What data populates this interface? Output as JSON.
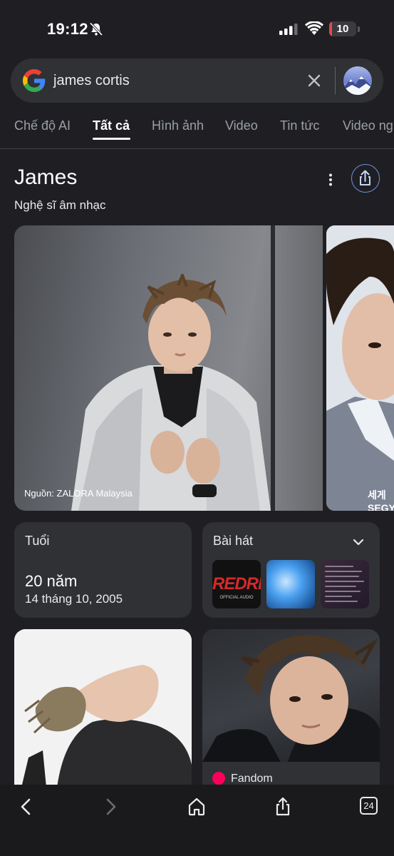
{
  "status_bar": {
    "time": "19:12",
    "battery": "10",
    "battery_level": 0.1
  },
  "search": {
    "query": "james cortis"
  },
  "tabs": [
    {
      "label": "Chế độ AI",
      "active": false
    },
    {
      "label": "Tất cả",
      "active": true
    },
    {
      "label": "Hình ảnh",
      "active": false
    },
    {
      "label": "Video",
      "active": false
    },
    {
      "label": "Tin tức",
      "active": false
    },
    {
      "label": "Video ng",
      "active": false
    }
  ],
  "knowledge_panel": {
    "title": "James",
    "subtitle": "Nghệ sĩ âm nhạc",
    "image_credit": "Nguồn: ZALORA Malaysia",
    "second_image_text": "세계\nSEGY"
  },
  "age_card": {
    "label": "Tuổi",
    "value": "20 năm",
    "date": "14 tháng 10, 2005"
  },
  "songs_card": {
    "label": "Bài hát",
    "thumb1_title": "REDRE",
    "thumb1_sub": "OFFICIAL AUDIO"
  },
  "results": {
    "right_source": "Fandom"
  },
  "toolbar": {
    "tab_count": "24"
  },
  "colors": {
    "background": "#1f1f23",
    "card": "#303134",
    "accent": "#6d8fe0",
    "battery_low": "#e5484d"
  }
}
